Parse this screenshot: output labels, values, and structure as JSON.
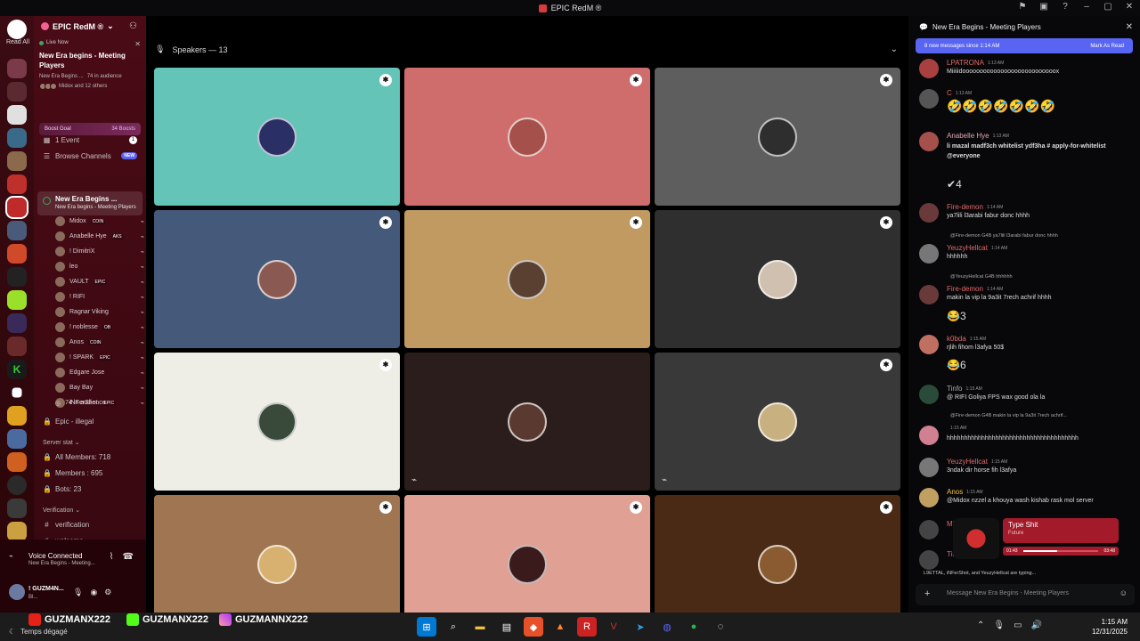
{
  "window": {
    "title": "EPIC RedM ®"
  },
  "rail": {
    "read_all": "Read All",
    "badge": "11"
  },
  "server": {
    "name": "EPIC RedM ®"
  },
  "live": {
    "badge": "Live Now",
    "title": "New Era begins - Meeting Players",
    "sub_channel": "New Era Begins ...",
    "audience": "74 in audience",
    "others": "Midox and 12 others"
  },
  "boost": {
    "label": "Boost Goal",
    "count": "34 Boosts"
  },
  "channels": {
    "events": "1 Event",
    "events_count": "1",
    "browse": "Browse Channels",
    "browse_badge": "NEW",
    "voice_name": "New Era Begins ...",
    "voice_sub": "New Era begins - Meeting Players",
    "audience": "74 in audience",
    "illegal": "Epic - illegal",
    "server_stat": "Server stat",
    "all_members": "All Members: 718",
    "members": "Members : 695",
    "bots": "Bots: 23",
    "verification_cat": "Verification",
    "verification": "verification",
    "welcome": "welcome"
  },
  "voice_members": [
    {
      "name": "Midox",
      "tag": "COIN"
    },
    {
      "name": "Anabelle Hye",
      "tag": "AKS"
    },
    {
      "name": "! DimitriX",
      "tag": ""
    },
    {
      "name": "leo",
      "tag": ""
    },
    {
      "name": "VAULT",
      "tag": "EPIC"
    },
    {
      "name": "! RIFI",
      "tag": ""
    },
    {
      "name": "Ragnar Viking",
      "tag": ""
    },
    {
      "name": "! noblesse",
      "tag": "OB"
    },
    {
      "name": "Anos",
      "tag": "COIN"
    },
    {
      "name": "! SPARK",
      "tag": "EPIC"
    },
    {
      "name": "Edgare Jose",
      "tag": ""
    },
    {
      "name": "Bay Bay",
      "tag": ""
    },
    {
      "name": "iNFerShot",
      "tag": "EPIC"
    }
  ],
  "user_panel": {
    "status": "Voice Connected",
    "channel": "New Era Begins - Meeting...",
    "name": "! GUZM4N...",
    "substatus": "Bl..."
  },
  "stage": {
    "speakers": "Speakers — 13"
  },
  "tiles": [
    {
      "bg": "#64c4b7",
      "mod": true,
      "mute": false,
      "av": "#2a2f66"
    },
    {
      "bg": "#cf6d6d",
      "mod": true,
      "mute": false,
      "av": "#a5504a"
    },
    {
      "bg": "#5e5e5e",
      "mod": true,
      "mute": false,
      "av": "#2e2e2e"
    },
    {
      "bg": "#45597a",
      "mod": true,
      "mute": false,
      "av": "#8a5a52"
    },
    {
      "bg": "#c09a60",
      "mod": true,
      "mute": false,
      "av": "#5a4030"
    },
    {
      "bg": "#2f2f2f",
      "mod": true,
      "mute": false,
      "av": "#d0c0b0"
    },
    {
      "bg": "#eeeee6",
      "mod": true,
      "mute": false,
      "av": "#3a4a3a"
    },
    {
      "bg": "#2b1d1b",
      "mod": false,
      "mute": true,
      "av": "#5a3a30"
    },
    {
      "bg": "#393939",
      "mod": true,
      "mute": true,
      "av": "#c8b080"
    },
    {
      "bg": "#a07652",
      "mod": true,
      "mute": false,
      "av": "#d8b070"
    },
    {
      "bg": "#e1a094",
      "mod": true,
      "mute": false,
      "av": "#3a1a1a"
    },
    {
      "bg": "#4a2a14",
      "mod": true,
      "mute": false,
      "av": "#8a5a30"
    }
  ],
  "chat": {
    "title": "New Era Begins - Meeting Players",
    "new_messages": "8 new messages since 1:14 AM",
    "mark_read": "Mark As Read",
    "messages": [
      {
        "name": "LPATRONA",
        "color": "#e06a6a",
        "time": "1:13 AM",
        "text": "Miiiiidooooooooooooooooooooooooooox",
        "av": "#a84040"
      },
      {
        "name": "C",
        "color": "#e06a6a",
        "time": "1:13 AM",
        "text": "🤣🤣🤣🤣🤣🤣🤣",
        "av": "#555"
      },
      {
        "name": "Anabelle Hye",
        "color": "#e2a6b0",
        "time": "1:13 AM",
        "text": "li mazal madf3ch whitelist ydf3ha # apply-for-whitelist @everyone",
        "av": "#a5504a"
      },
      {
        "name": "Fire-demon",
        "color": "#e06a6a",
        "time": "1:14 AM",
        "text": "ya7lili l3arabi fabur donc hhhh",
        "av": "#6a3a3a"
      },
      {
        "name": "YeuzyHellcat",
        "color": "#e06a6a",
        "time": "1:14 AM",
        "text": "hhhhhh",
        "av": "#777"
      },
      {
        "name": "Fire-demon",
        "color": "#e06a6a",
        "time": "1:14 AM",
        "text": "makin la vip la 9a3it 7rech achrif hhhh",
        "av": "#6a3a3a"
      },
      {
        "name": "k0bda",
        "color": "#e06a6a",
        "time": "1:15 AM",
        "text": "rjlih fihom l3afya 50$",
        "av": "#c07060"
      },
      {
        "name": "Tinfo",
        "color": "#aaaaaa",
        "time": "1:15 AM",
        "text": "@ RIFI Goliya FPS wax good ola la",
        "av": "#2a4a3a"
      },
      {
        "name": "",
        "color": "#aaaaaa",
        "time": "1:15 AM",
        "text": "hhhhhhhhhhhhhhhhhhhhhhhhhhhhhhhhhhhhhh",
        "av": "#d08090"
      },
      {
        "name": "YeuzyHellcat",
        "color": "#e06a6a",
        "time": "1:15 AM",
        "text": "3ndak dir horse fih l3afya",
        "av": "#777"
      },
      {
        "name": "Anos",
        "color": "#f0c040",
        "time": "1:15 AM",
        "text": "@Midox nzzel a khouya wash kishab rask mol server",
        "av": "#c0a060"
      }
    ],
    "reactions": [
      {
        "emoji": "✔",
        "count": "4"
      },
      {
        "emoji": "😂",
        "count": "3"
      },
      {
        "emoji": "😂",
        "count": "6"
      }
    ],
    "replies": [
      "@Fire-demon  G4B  ya7lili l3arabi fabur donc hhhh",
      "@YeuzyHellcat  G4B  hhhhhh",
      "@Fire-demon  G4B  makin la vip la 9a3it 7rech achrif..."
    ],
    "extra_names": [
      "Mid",
      "Tim"
    ],
    "typing": "L9ETTAL, iNFerShot, and YeuzyHellcat are typing...",
    "placeholder": "Message New Era Begins - Meeting Players"
  },
  "music": {
    "title": "Type Shit",
    "artist": "Future",
    "elapsed": "01:43",
    "total": "03:48",
    "progress": 0.45
  },
  "taskbar": {
    "tags": [
      "GUZMANX222",
      "GUZMANX222",
      "GUZMANNX222"
    ],
    "weather": "Temps dégagé",
    "time": "1:15 AM",
    "date": "12/31/2025"
  }
}
